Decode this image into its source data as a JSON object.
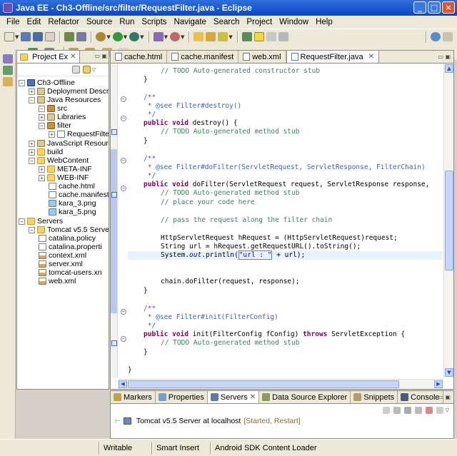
{
  "window": {
    "title": "Java EE - Ch3-Offline/src/filter/RequestFilter.java - Eclipse"
  },
  "menu": [
    "File",
    "Edit",
    "Refactor",
    "Source",
    "Run",
    "Scripts",
    "Navigate",
    "Search",
    "Project",
    "Window",
    "Help"
  ],
  "explorer": {
    "tab_label": "Project Ex",
    "nodes": [
      {
        "label": "Ch3-Offline"
      },
      {
        "label": "Deployment Descrip"
      },
      {
        "label": "Java Resources"
      },
      {
        "label": "src"
      },
      {
        "label": "Libraries"
      },
      {
        "label": "filter"
      },
      {
        "label": "RequestFilter"
      },
      {
        "label": "JavaScript Resourc"
      },
      {
        "label": "build"
      },
      {
        "label": "WebContent"
      },
      {
        "label": "META-INF"
      },
      {
        "label": "WEB-INF"
      },
      {
        "label": "cache.html"
      },
      {
        "label": "cache.manifest"
      },
      {
        "label": "kara_3.png"
      },
      {
        "label": "kara_5.png"
      },
      {
        "label": "Servers"
      },
      {
        "label": "Tomcat v5.5 Server"
      },
      {
        "label": "catalina.policy"
      },
      {
        "label": "catalina.properti"
      },
      {
        "label": "context.xml"
      },
      {
        "label": "server.xml"
      },
      {
        "label": "tomcat-users.xn"
      },
      {
        "label": "web.xml"
      }
    ]
  },
  "editor": {
    "tabs": [
      "cache.html",
      "cache.manifest",
      "web.xml",
      "RequestFilter.java"
    ],
    "active_tab": "RequestFilter.java",
    "code": {
      "l0": "// TODO Auto-generated constructor stub",
      "l1": "}",
      "l2": "/**",
      "l3a": " * @see ",
      "l3b": "Filter#destroy()",
      "l4": " */",
      "l5a": "public void ",
      "l5b": "destroy() {",
      "l6": "// TODO Auto-generated method stub",
      "l7": "}",
      "l8": "/**",
      "l9a": " * @see ",
      "l9b": "Filter#doFilter(ServletRequest, ServletResponse, FilterChain)",
      "l10": " */",
      "l11a": "public void ",
      "l11b": "doFilter(ServletRequest request, ServletResponse response,",
      "l12": "// TODO Auto-generated method stub",
      "l13": "// place your code here",
      "l14": "// pass the request along the filter chain",
      "l15": "HttpServletRequest hRequest = (HttpServletRequest)request;",
      "l16": "String url = hRequest.getRequestURL().toString();",
      "l17a": "System.",
      "l17b": "out",
      "l17c": ".println(",
      "l17d": "\"url : \"",
      "l17e": " + url);",
      "l18": "chain.doFilter(request, response);",
      "l19": "}",
      "l20": "/**",
      "l21a": " * @see ",
      "l21b": "Filter#init(FilterConfig)",
      "l22": " */",
      "l23a": "public void ",
      "l23b": "init(FilterConfig fConfig) ",
      "l23c": "throws",
      "l23d": " ServletException {",
      "l24": "// TODO Auto-generated method stub",
      "l25": "}",
      "l26": "}"
    }
  },
  "bottom_panel": {
    "tabs": [
      "Markers",
      "Properties",
      "Servers",
      "Data Source Explorer",
      "Snippets",
      "Console"
    ],
    "active_tab": "Servers",
    "server": {
      "name": "Tomcat v5.5 Server at localhost",
      "state": "[Started, Restart]"
    }
  },
  "status_bar": {
    "mode": "Writable",
    "insert": "Smart Insert",
    "loader": "Android SDK Content Loader"
  }
}
